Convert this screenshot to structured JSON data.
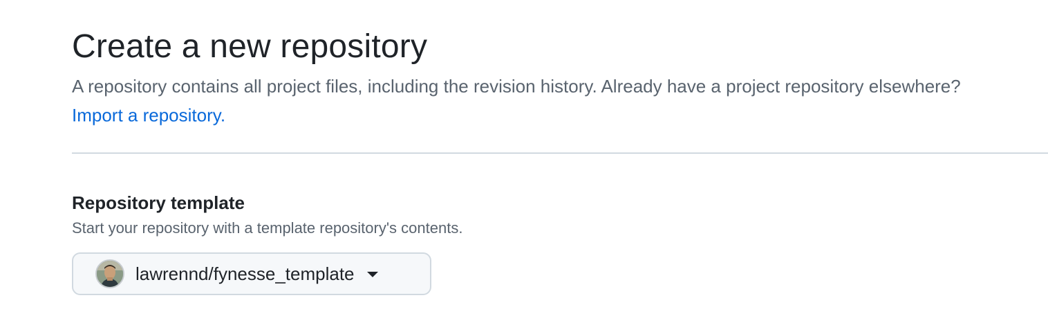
{
  "header": {
    "title": "Create a new repository",
    "description": "A repository contains all project files, including the revision history. Already have a project repository elsewhere?",
    "import_link": "Import a repository."
  },
  "template_section": {
    "title": "Repository template",
    "description": "Start your repository with a template repository's contents.",
    "selected_template": "lawrennd/fynesse_template",
    "avatar_icon": "user-avatar",
    "dropdown_icon": "triangle-down-icon"
  },
  "colors": {
    "link": "#0969da",
    "text_primary": "#1f2328",
    "text_muted": "#59636e",
    "border": "#d1d9e0",
    "button_bg": "#f6f8fa"
  }
}
